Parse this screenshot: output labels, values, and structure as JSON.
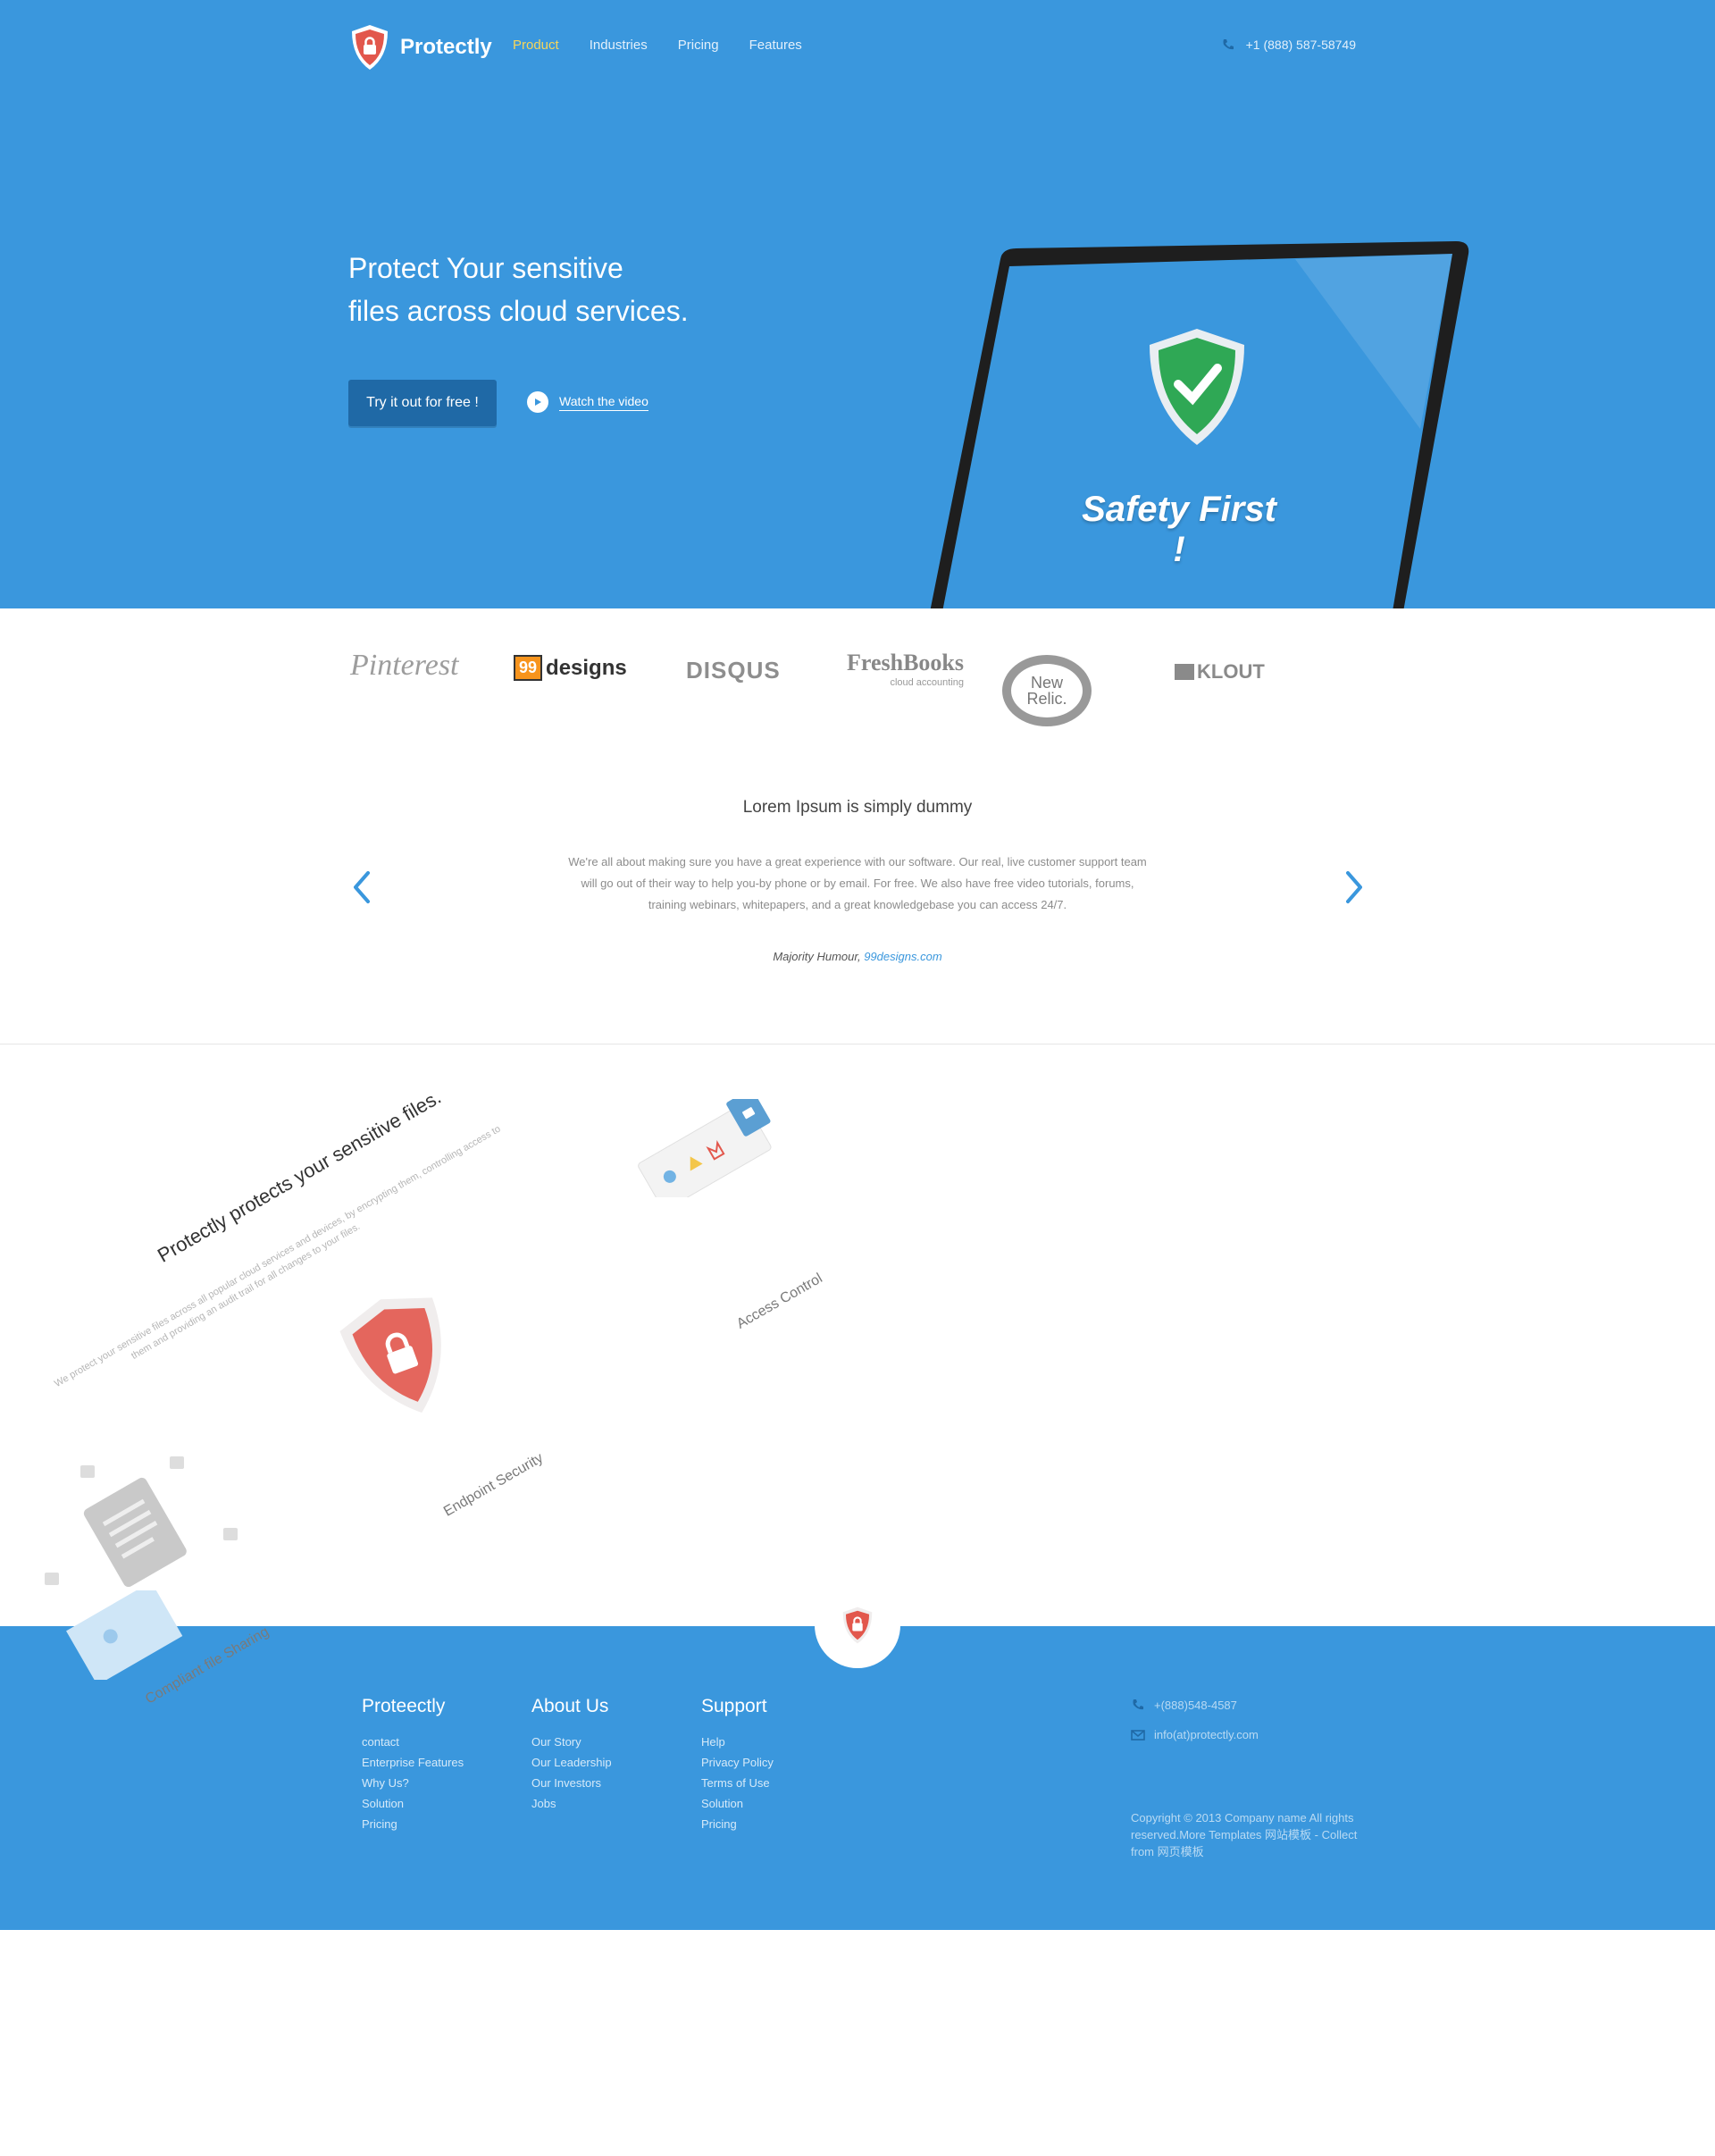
{
  "header": {
    "brand": "Protectly",
    "nav": [
      {
        "label": "Product",
        "active": true
      },
      {
        "label": "Industries",
        "active": false
      },
      {
        "label": "Pricing",
        "active": false
      },
      {
        "label": "Features",
        "active": false
      }
    ],
    "phone": "+1 (888) 587-58749"
  },
  "hero": {
    "title_line1": "Protect Your sensitive",
    "title_line2": "files across cloud services.",
    "cta_label": "Try it out for free !",
    "video_label": "Watch the video",
    "screen_text": "Safety First !"
  },
  "partners": {
    "pinterest": "Pinterest",
    "ninety_nine_box": "99",
    "ninety_nine_text": "designs",
    "disqus": "DISQUS",
    "freshbooks": "FreshBooks",
    "freshbooks_sub": "cloud accounting",
    "newrelic_line1": "New",
    "newrelic_line2": "Relic.",
    "klout": "KLOUT"
  },
  "testimonial": {
    "title": "Lorem Ipsum is simply dummy",
    "body": "We're all about making sure you have a great experience with our software. Our real, live customer support team will go out of their way to help you-by phone or by email. For free. We also have free video tutorials, forums, training webinars, whitepapers, and a great knowledgebase you can access 24/7.",
    "author": "Majority Humour,",
    "author_link": "99designs.com"
  },
  "features": {
    "title": "Protectly protects your sensitive files.",
    "sub_line1": "We protect your sensitive files across all popular cloud services and devices, by encrypting them, controlling access to",
    "sub_line2": "them and providing an audit trail for all changes to your files.",
    "access_control": "Access Control",
    "endpoint_security": "Endpoint Security",
    "compliant_sharing": "Compliant file Sharing"
  },
  "footer": {
    "col1": {
      "title": "Proteectly",
      "links": [
        "contact",
        "Enterprise Features",
        "Why Us?",
        "Solution",
        "Pricing"
      ]
    },
    "col2": {
      "title": "About Us",
      "links": [
        "Our Story",
        "Our Leadership",
        "Our Investors",
        "Jobs"
      ]
    },
    "col3": {
      "title": "Support",
      "links": [
        "Help",
        "Privacy Policy",
        "Terms of Use",
        "Solution",
        "Pricing"
      ]
    },
    "phone": "+(888)548-4587",
    "email": "info(at)protectly.com",
    "copyright": "Copyright © 2013 Company name All rights reserved.More Templates 网站模板 - Collect from 网页模板"
  },
  "colors": {
    "primary_blue": "#3a97dd",
    "button_dark_blue": "#1f69a6",
    "accent_yellow": "#f7d65a",
    "shield_red": "#e2574c",
    "shield_green": "#2fa855"
  }
}
